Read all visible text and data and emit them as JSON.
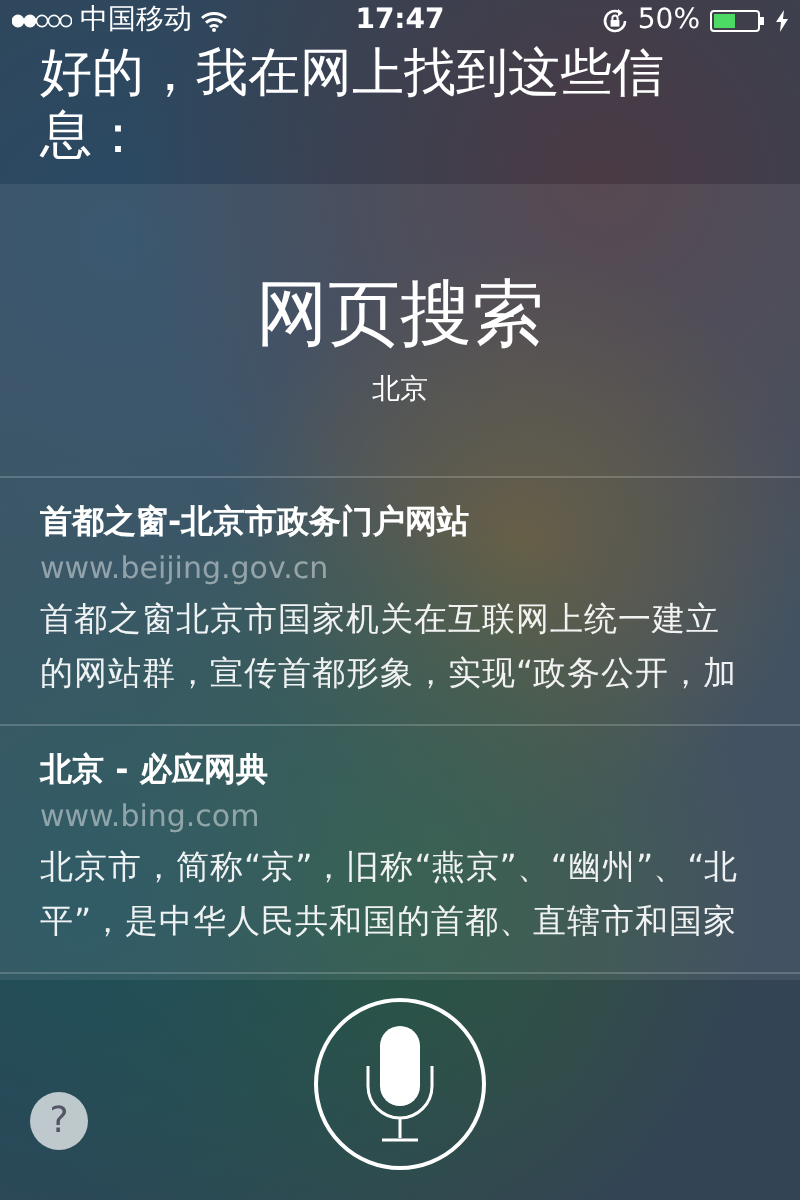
{
  "status_bar": {
    "carrier": "中国移动",
    "time": "17:47",
    "battery_percent": "50%",
    "battery": {
      "level": 0.5,
      "charging": true
    },
    "rotation_lock": true
  },
  "siri_reply": "好的，我在网上找到这些信息：",
  "web_search": {
    "title": "网页搜索",
    "query": "北京",
    "results": [
      {
        "title": "首都之窗-北京市政务门户网站",
        "url": "www.beijing.gov.cn",
        "snippet_lines": [
          "首都之窗北京市国家机关在互联网上统一建立",
          "的网站群，宣传首都形象，实现“政务公开，加"
        ]
      },
      {
        "title": "北京 - 必应网典",
        "url": "www.bing.com",
        "snippet_lines": [
          "北京市，简称“京”，旧称“燕京”、“幽州”、“北",
          "平”，是中华人民共和国的首都、直辖市和国家"
        ]
      }
    ]
  },
  "help_button": "?"
}
